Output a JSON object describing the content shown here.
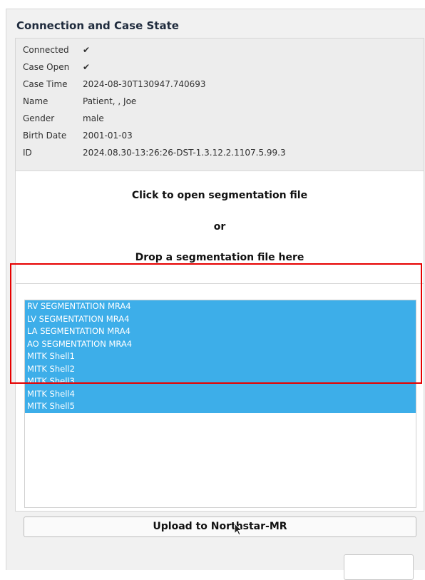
{
  "connection": {
    "title": "Connection and Case State",
    "rows": [
      {
        "label": "Connected",
        "value": "✔"
      },
      {
        "label": "Case Open",
        "value": "✔"
      },
      {
        "label": "Case Time",
        "value": "2024-08-30T130947.740693"
      },
      {
        "label": "Name",
        "value": "Patient, , Joe"
      },
      {
        "label": "Gender",
        "value": "male"
      },
      {
        "label": "Birth Date",
        "value": "2001-01-03"
      },
      {
        "label": "ID",
        "value": "2024.08.30-13:26:26-DST-1.3.12.2.1107.5.99.3"
      }
    ]
  },
  "drop_zone": {
    "line1": "Click to open segmentation file",
    "line2": "or",
    "line3": "Drop a segmentation file here"
  },
  "segments": {
    "items": [
      "RV SEGMENTATION MRA4",
      "LV SEGMENTATION MRA4",
      "LA SEGMENTATION MRA4",
      "AO SEGMENTATION MRA4",
      "MITK Shell1",
      "MITK Shell2",
      "MITK Shell3",
      "MITK Shell4",
      "MITK Shell5"
    ]
  },
  "upload": {
    "label": "Upload to Northstar-MR"
  },
  "colors": {
    "selection": "#3daee9",
    "highlight_border": "#e60000"
  }
}
